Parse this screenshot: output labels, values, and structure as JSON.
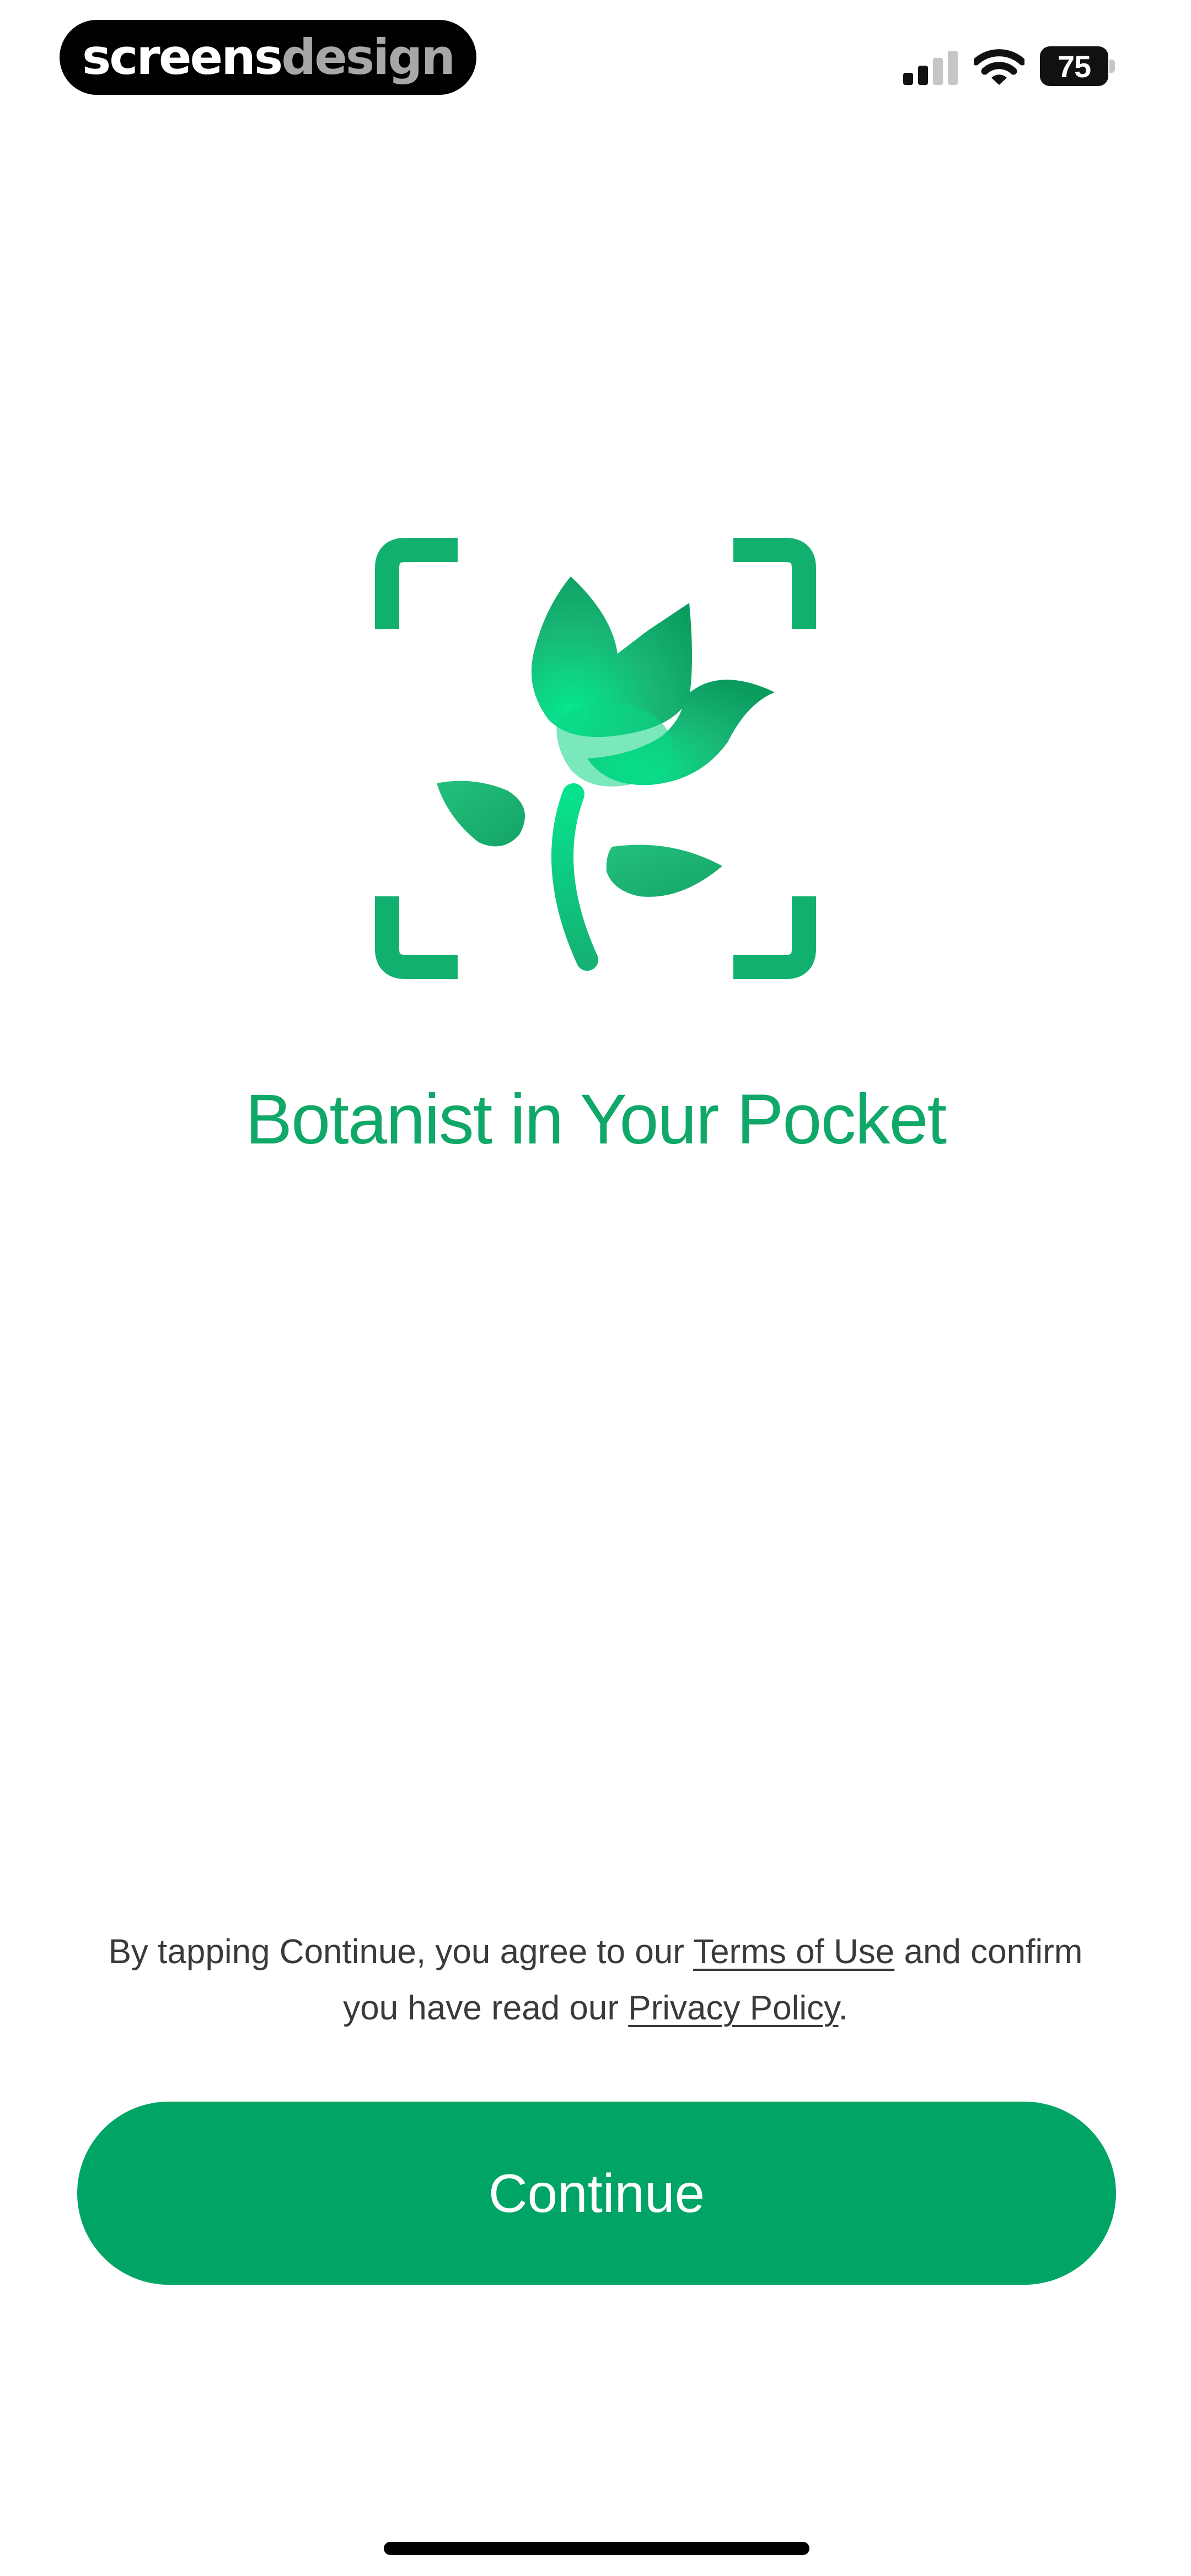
{
  "watermark": {
    "part1": "screens",
    "part2": "design"
  },
  "status_bar": {
    "battery_level": "75",
    "signal_icon": "signal-bars-icon",
    "wifi_icon": "wifi-icon"
  },
  "app": {
    "logo_icon": "plant-scan-icon",
    "title": "Botanist in Your Pocket"
  },
  "legal": {
    "prefix": "By tapping Continue, you agree to our ",
    "terms_link": "Terms of Use",
    "middle": " and confirm you have read our ",
    "privacy_link": "Privacy Policy",
    "suffix": "."
  },
  "actions": {
    "continue_label": "Continue"
  },
  "colors": {
    "brand_green": "#00a565",
    "title_green": "#10a868",
    "text_gray": "#3a3a3c"
  }
}
